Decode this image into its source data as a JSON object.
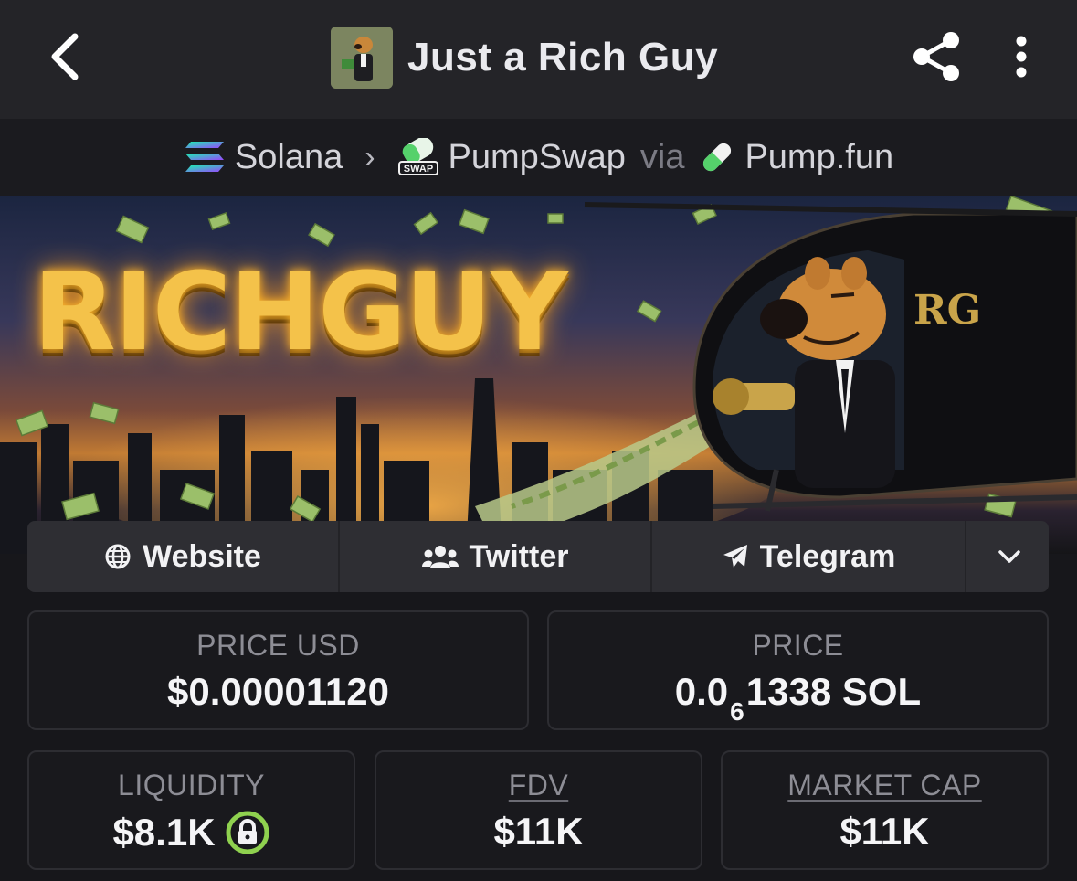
{
  "header": {
    "title": "Just a Rich Guy",
    "back_icon": "chevron-left-icon",
    "share_icon": "share-icon",
    "more_icon": "more-vertical-icon"
  },
  "breadcrumb": {
    "chain": "Solana",
    "dex": "PumpSwap",
    "dex_badge": "SWAP",
    "via": "via",
    "launchpad": "Pump.fun"
  },
  "banner": {
    "title": "RICHGUY",
    "badge": "RG"
  },
  "links": {
    "website": "Website",
    "twitter": "Twitter",
    "telegram": "Telegram",
    "expand_icon": "chevron-down-icon"
  },
  "stats": {
    "price_usd_label": "PRICE USD",
    "price_usd_value": "$0.00001120",
    "price_label": "PRICE",
    "price_prefix": "0.0",
    "price_zeros": "6",
    "price_digits": "1338 SOL",
    "liquidity_label": "LIQUIDITY",
    "liquidity_value": "$8.1K",
    "fdv_label": "FDV",
    "fdv_value": "$11K",
    "mcap_label": "MARKET CAP",
    "mcap_value": "$11K"
  },
  "colors": {
    "background": "#17171b",
    "lock_green": "#8fd14f",
    "banner_gold": "#f4c24a"
  }
}
